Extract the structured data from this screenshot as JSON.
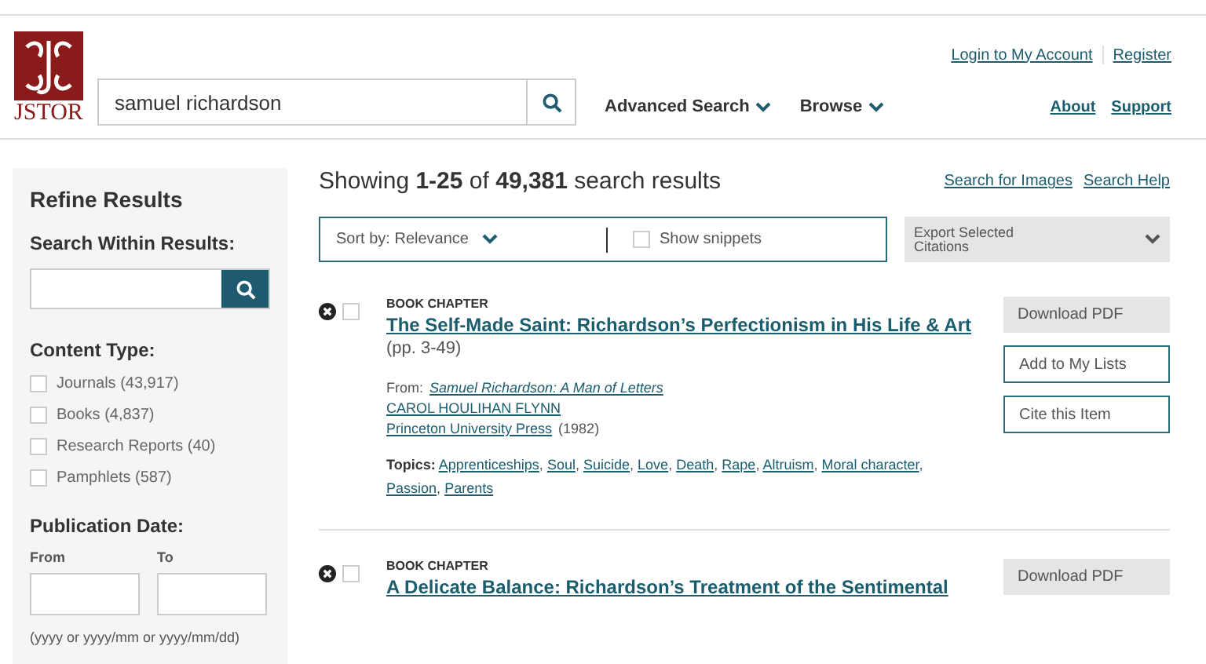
{
  "header": {
    "logo": "JSTOR",
    "search": {
      "value": "samuel richardson"
    },
    "nav": [
      "Advanced Search",
      "Browse"
    ],
    "account_links": [
      "Login to My Account",
      "Register"
    ],
    "info_links": [
      "About",
      "Support"
    ]
  },
  "sidebar": {
    "title": "Refine Results",
    "search_within": {
      "label": "Search Within Results:"
    },
    "content_type": {
      "heading": "Content Type:",
      "options": [
        {
          "label": "Journals (43,917)",
          "checked": false
        },
        {
          "label": "Books (4,837)",
          "checked": false
        },
        {
          "label": "Research Reports (40)",
          "checked": false
        },
        {
          "label": "Pamphlets (587)",
          "checked": false
        }
      ]
    },
    "publication_date": {
      "heading": "Publication Date:",
      "from_label": "From",
      "to_label": "To",
      "hint": "(yyyy or yyyy/mm or yyyy/mm/dd)"
    }
  },
  "results_header": {
    "summary": "Showing **1-25** of **49,381** search results",
    "links": [
      "Search for Images",
      "Search Help"
    ]
  },
  "toolbar": {
    "sort": "Sort by: Relevance",
    "show_snippets": {
      "label": "Show snippets",
      "checked": false
    },
    "export": "Export Selected Citations"
  },
  "results": [
    {
      "type": "BOOK CHAPTER",
      "checked": false,
      "title": "The Self-Made Saint: Richardson’s Perfectionism in His Life & Art",
      "pages": "(pp. 3-49)",
      "from_label": "From:",
      "from_title": "Samuel Richardson: A Man of Letters",
      "author": "CAROL HOULIHAN FLYNN",
      "publisher": "Princeton University Press",
      "year": "(1982)",
      "topics_label": "Topics:",
      "topic_separator": ",",
      "topics": [
        "Apprenticeships",
        "Soul",
        "Suicide",
        "Love",
        "Death",
        "Rape",
        "Altruism",
        "Moral character",
        "Passion",
        "Parents"
      ],
      "actions": [
        {
          "label": "Download PDF",
          "kind": "filled"
        },
        {
          "label": "Add to My Lists",
          "kind": "outline"
        },
        {
          "label": "Cite this Item",
          "kind": "outline"
        }
      ]
    },
    {
      "type": "BOOK CHAPTER",
      "checked": false,
      "title": "A Delicate Balance: Richardson’s Treatment of the Sentimental",
      "actions": [
        {
          "label": "Download PDF",
          "kind": "filled"
        }
      ]
    }
  ]
}
